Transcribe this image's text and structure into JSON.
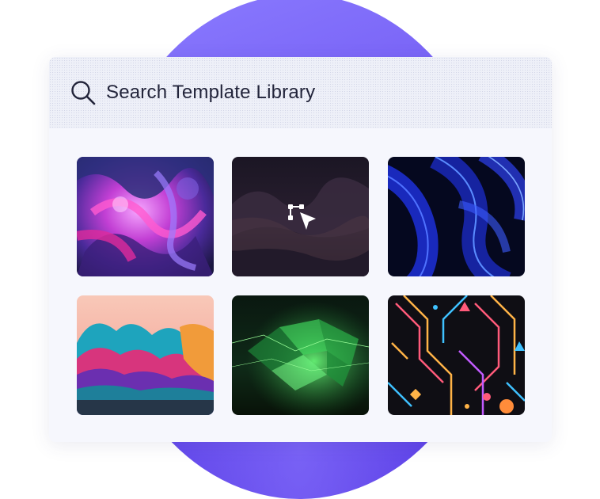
{
  "search": {
    "placeholder": "Search Template Library",
    "icon": "search-icon"
  },
  "templates": [
    {
      "name": "purple-paint-splash",
      "palette": [
        "#2b1d5c",
        "#e23fb8",
        "#6f3fd0"
      ]
    },
    {
      "name": "dark-landscape-selected",
      "palette": [
        "#1c1527",
        "#3d2a3a"
      ],
      "overlay_icon": "select-cursor-icon"
    },
    {
      "name": "blue-neon-curves",
      "palette": [
        "#060a2a",
        "#2844ff"
      ]
    },
    {
      "name": "colorful-waves",
      "palette": [
        "#1a8fa8",
        "#e6407a",
        "#f29b3b"
      ]
    },
    {
      "name": "green-polygon-field",
      "palette": [
        "#0b1a12",
        "#2fd35a"
      ]
    },
    {
      "name": "geometric-neon-pattern",
      "palette": [
        "#0f0f14",
        "#ff5a7a",
        "#ffb347",
        "#3fc1ff"
      ]
    }
  ],
  "colors": {
    "circle": "#6f56f2",
    "card": "#f6f7fd",
    "text": "#22243a"
  }
}
